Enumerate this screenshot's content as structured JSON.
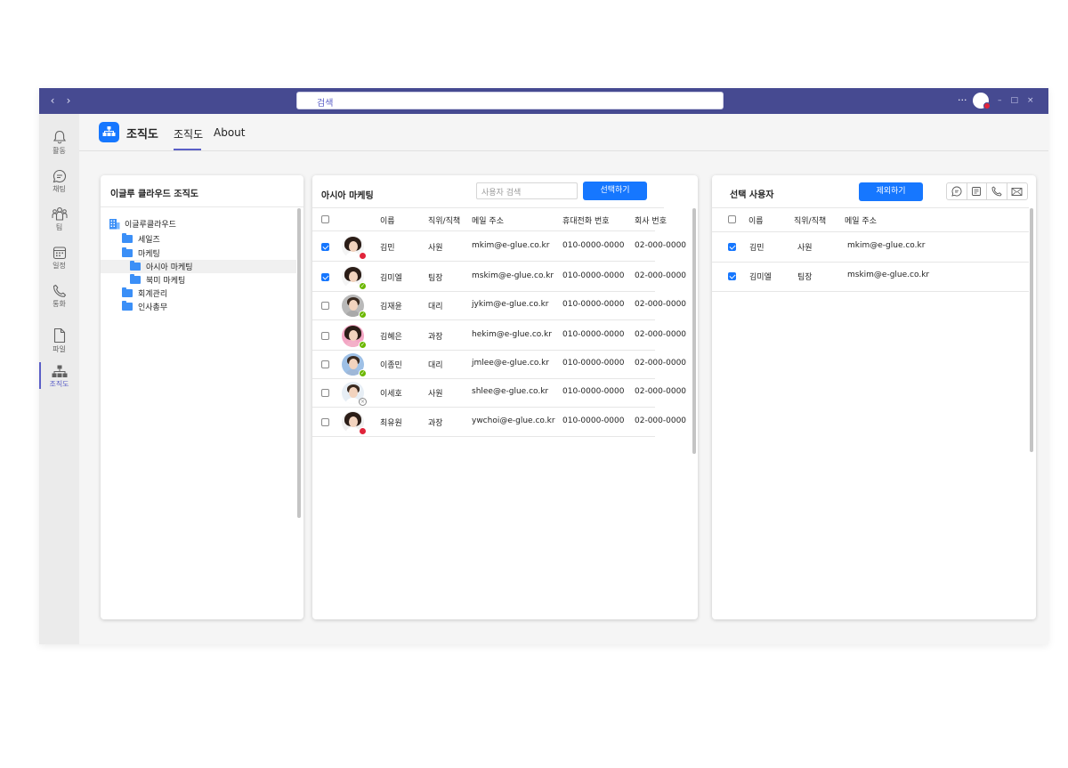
{
  "titlebar": {
    "search_placeholder": "검색",
    "more_label": "···",
    "window_controls": [
      "–",
      "□",
      "×"
    ]
  },
  "rail": [
    {
      "icon": "bell-icon",
      "label": "활동"
    },
    {
      "icon": "chat-icon",
      "label": "채팅"
    },
    {
      "icon": "teams-icon",
      "label": "팀"
    },
    {
      "icon": "calendar-icon",
      "label": "일정"
    },
    {
      "icon": "phone-icon",
      "label": "통화"
    },
    {
      "icon": "file-icon",
      "label": "파일"
    },
    {
      "icon": "org-chart-icon",
      "label": "조직도",
      "active": true
    }
  ],
  "header": {
    "app_title": "조직도",
    "tabs": [
      {
        "label": "조직도",
        "active": true
      },
      {
        "label": "About",
        "active": false
      }
    ]
  },
  "tree": {
    "title": "이글루 클라우드 조직도",
    "root": "이글루클라우드",
    "nodes": [
      {
        "label": "세일즈",
        "level": 1
      },
      {
        "label": "마케팅",
        "level": 1
      },
      {
        "label": "아시아 마케팅",
        "level": 2,
        "selected": true
      },
      {
        "label": "북미 마케팅",
        "level": 2
      },
      {
        "label": "회계관리",
        "level": 1
      },
      {
        "label": "인사총무",
        "level": 1
      }
    ]
  },
  "users": {
    "title": "아시아 마케팅",
    "search_placeholder": "사용자 검색",
    "select_button": "선택하기",
    "columns": [
      "이름",
      "직위/직책",
      "메일 주소",
      "휴대전화 번호",
      "회사 번호"
    ],
    "rows": [
      {
        "checked": true,
        "name": "김민",
        "position": "사원",
        "email": "mkim@e-glue.co.kr",
        "mobile": "010-0000-0000",
        "office": "02-000-0000",
        "status": "busy",
        "avatar_gender": "f"
      },
      {
        "checked": true,
        "name": "김미엘",
        "position": "팀장",
        "email": "mskim@e-glue.co.kr",
        "mobile": "010-0000-0000",
        "office": "02-000-0000",
        "status": "online",
        "avatar_gender": "f"
      },
      {
        "checked": false,
        "name": "김재윤",
        "position": "대리",
        "email": "jykim@e-glue.co.kr",
        "mobile": "010-0000-0000",
        "office": "02-000-0000",
        "status": "online",
        "avatar_gender": "m"
      },
      {
        "checked": false,
        "name": "김혜은",
        "position": "과장",
        "email": "hekim@e-glue.co.kr",
        "mobile": "010-0000-0000",
        "office": "02-000-0000",
        "status": "online",
        "avatar_gender": "f"
      },
      {
        "checked": false,
        "name": "이종민",
        "position": "대리",
        "email": "jmlee@e-glue.co.kr",
        "mobile": "010-0000-0000",
        "office": "02-000-0000",
        "status": "online",
        "avatar_gender": "m"
      },
      {
        "checked": false,
        "name": "이세호",
        "position": "사원",
        "email": "shlee@e-glue.co.kr",
        "mobile": "010-0000-0000",
        "office": "02-000-0000",
        "status": "offline",
        "avatar_gender": "m"
      },
      {
        "checked": false,
        "name": "최유원",
        "position": "과장",
        "email": "ywchoi@e-glue.co.kr",
        "mobile": "010-0000-0000",
        "office": "02-000-0000",
        "status": "busy",
        "avatar_gender": "f"
      }
    ]
  },
  "selected": {
    "title": "선택 사용자",
    "exclude_button": "제외하기",
    "actions": [
      "chat-icon",
      "form-icon",
      "phone-icon",
      "mail-icon"
    ],
    "columns": [
      "이름",
      "직위/직책",
      "메일 주소"
    ],
    "rows": [
      {
        "checked": true,
        "name": "김민",
        "position": "사원",
        "email": "mkim@e-glue.co.kr"
      },
      {
        "checked": true,
        "name": "김미엘",
        "position": "팀장",
        "email": "mskim@e-glue.co.kr"
      }
    ]
  },
  "colors": {
    "titlebar": "#464a91",
    "accent": "#5b5fc7",
    "primary_button": "#1677ff",
    "busy": "#e0243a",
    "online": "#6bb700"
  }
}
